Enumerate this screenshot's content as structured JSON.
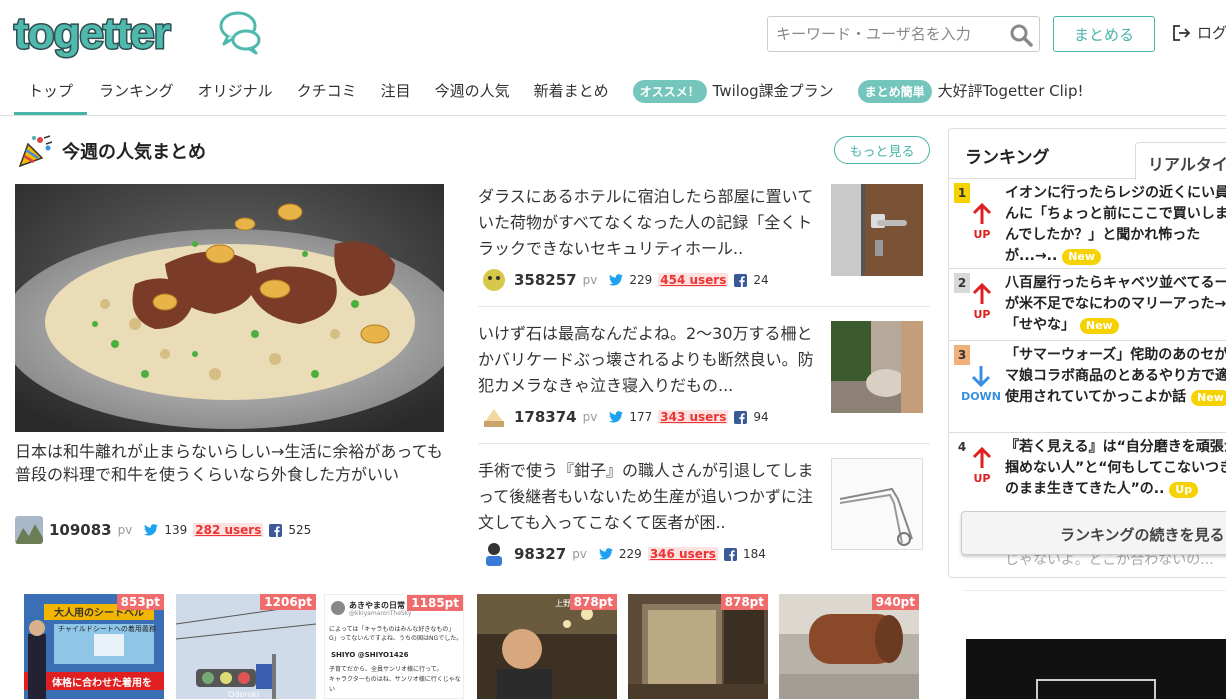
{
  "header": {
    "logo_text": "togetter",
    "search_placeholder": "キーワード・ユーザ名を入力",
    "matome_label": "まとめる",
    "login_label": "ログ"
  },
  "nav": {
    "items": [
      "トップ",
      "ランキング",
      "オリジナル",
      "クチコミ",
      "注目",
      "今週の人気",
      "新着まとめ"
    ],
    "promo1_badge": "オススメ！",
    "promo1_text": "Twilog課金プラン",
    "promo2_badge": "まとめ簡単",
    "promo2_text": "大好評Togetter Clip!"
  },
  "section": {
    "title": "今週の人気まとめ",
    "more_label": "もっと見る"
  },
  "feature": {
    "title": "日本は和牛離れが止まらないらしい→生活に余裕があっても普段の料理で和牛を使うくらいなら外食した方がいい",
    "pv": "109083",
    "pv_unit": "pv",
    "tw": "139",
    "users": "282 users",
    "fb": "525"
  },
  "side_items": [
    {
      "title": "ダラスにあるホテルに宿泊したら部屋に置いていた荷物がすべてなくなった人の記録「全くトラックできないセキュリティホール..",
      "pv": "358257",
      "pv_unit": "pv",
      "tw": "229",
      "users": "454 users",
      "fb": "24"
    },
    {
      "title": "いけず石は最高なんだよね。2〜30万する柵とかバリケードぶっ壊されるよりも断然良い。防犯カメラなきゃ泣き寝入りだもの...",
      "pv": "178374",
      "pv_unit": "pv",
      "tw": "177",
      "users": "343 users",
      "fb": "94"
    },
    {
      "title": "手術で使う『鉗子』の職人さんが引退してしまって後継者もいないため生産が追いつかずに注文しても入ってこなくて医者が困..",
      "pv": "98327",
      "pv_unit": "pv",
      "tw": "229",
      "users": "346 users",
      "fb": "184"
    }
  ],
  "ranking": {
    "title": "ランキング",
    "tab": "リアルタイ",
    "rows": [
      {
        "num": "1",
        "dir": "UP",
        "text": "イオンに行ったらレジの近くにい員さんに「ちょっと前にここで買いしませんでしたか？」と聞かれ怖ったが...→..",
        "badge": "New"
      },
      {
        "num": "2",
        "dir": "UP",
        "text": "八百屋行ったらキャベツ並べてるールが米不足でなにわのマリーアった→「せやな」",
        "badge": "New"
      },
      {
        "num": "3",
        "dir": "DOWN",
        "text": "「サマーウォーズ」侘助のあのセがウマ娘コラボ商品のとあるやり方で適切使用されていてかっこよか話",
        "badge": "New"
      },
      {
        "num": "4",
        "dir": "UP",
        "text": "『若く見える』は“自分磨きを頑張か掴めない人”と“何もしてこないつきのまま生きてきた人”の..",
        "badge": "Up"
      }
    ],
    "more_label": "ランキングの続きを見る",
    "fade_text": "じゃないよ。どこか合わないの..."
  },
  "thumbs": [
    {
      "pt": "853pt"
    },
    {
      "pt": "1206pt"
    },
    {
      "pt": "1185pt"
    },
    {
      "pt": "878pt"
    },
    {
      "pt": "878pt"
    },
    {
      "pt": "940pt"
    }
  ],
  "thumb_texts": {
    "t1_banner": "大人用のシートベル",
    "t1_sub": "チャイルドシートへの着用義務",
    "t1_caption": "体格に合わせた着用を",
    "t2_sign": "Odoroki",
    "t3_name": "あきやまの日常",
    "t3_handle": "@kkiyamanInTheSky",
    "t3_line1": "によっては「キャラものはみんな好きなもの」",
    "t3_line2": "G」ってないんですよね、うちの国はNGでした。",
    "t3_user2": "SHIYO @SHIYO1426",
    "t3_line3": "子育てだから、全員サンリオ様に行って。",
    "t3_line4": "キャラクターものはね、サンリオ様に行くじゃない",
    "t4_sign": "上野"
  },
  "colors": {
    "accent": "#49b4a8",
    "users_red": "#e33333",
    "twitter": "#1da1f2",
    "facebook": "#3b5998",
    "rank_up": "#e02020",
    "rank_down": "#3a8fe0",
    "point": "#f06b6b"
  }
}
